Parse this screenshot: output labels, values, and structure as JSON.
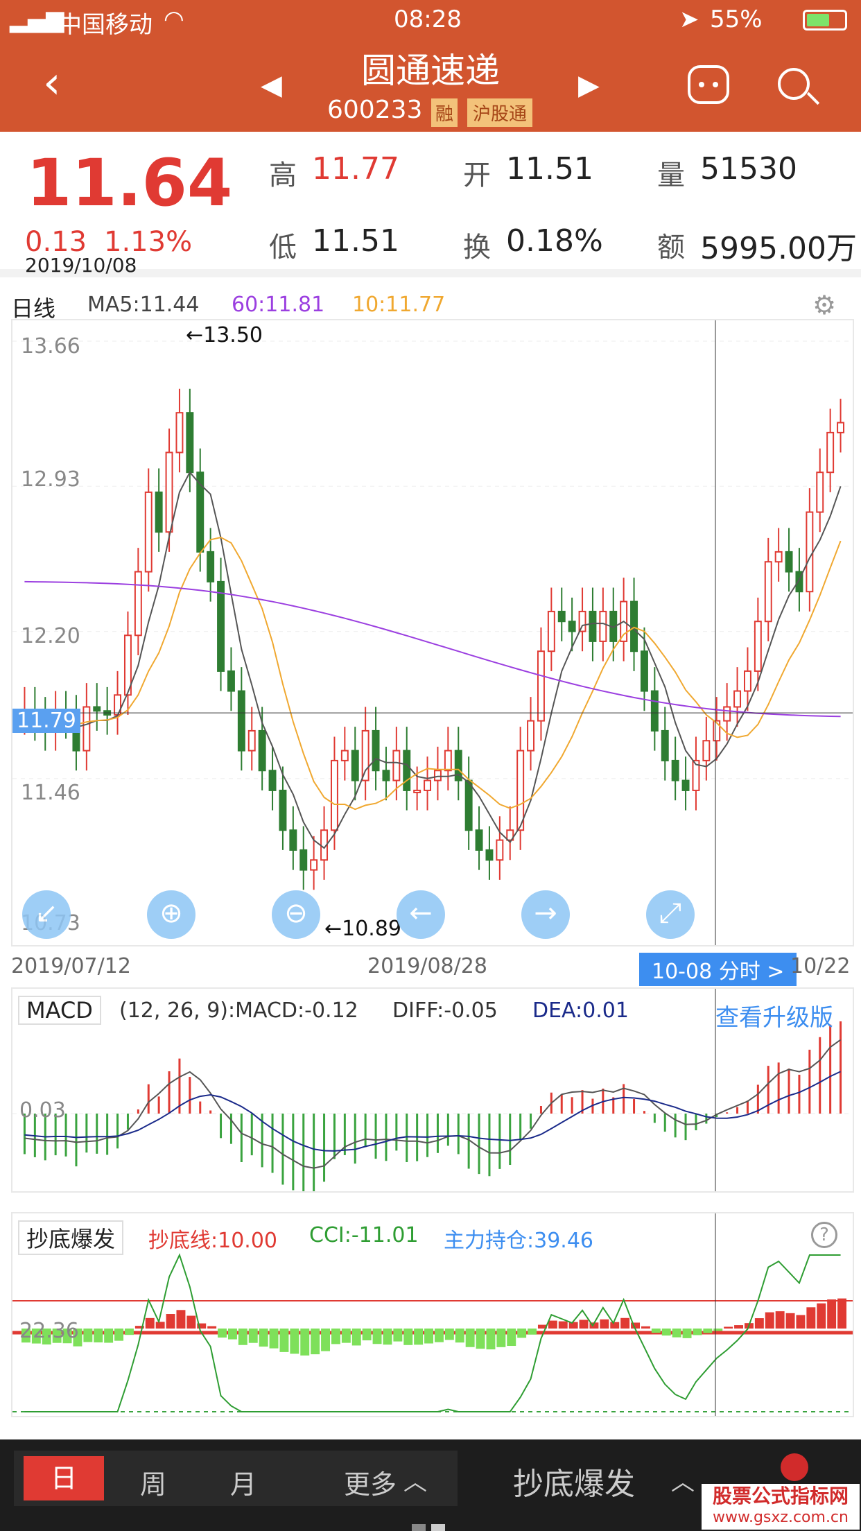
{
  "status_bar": {
    "carrier": "中国移动",
    "time": "08:28",
    "battery": "55%"
  },
  "header": {
    "title": "圆通速递",
    "code": "600233",
    "badge1": "融",
    "badge2": "沪股通"
  },
  "quote": {
    "price": "11.64",
    "change": "0.13",
    "change_pct": "1.13%",
    "date": "2019/10/08",
    "high_label": "高",
    "high": "11.77",
    "open_label": "开",
    "open": "11.51",
    "volume_label": "量",
    "volume": "51530",
    "low_label": "低",
    "low": "11.51",
    "turnover_label": "换",
    "turnover": "0.18%",
    "amount_label": "额",
    "amount": "5995.00万"
  },
  "kline": {
    "period": "日线",
    "ma5": "MA5:11.44",
    "ma60": "60:11.81",
    "ma10": "10:11.77",
    "y_labels": [
      "13.66",
      "12.93",
      "12.20",
      "11.46",
      "10.73"
    ],
    "crosshair_price": "11.79",
    "max_label": "←13.50",
    "min_label": "←10.89",
    "x_labels": [
      "2019/07/12",
      "2019/08/28",
      "10/22"
    ],
    "time_button": "10-08 分时 >"
  },
  "macd": {
    "name": "MACD",
    "params": "(12, 26, 9):MACD:-0.12",
    "diff": "DIFF:-0.05",
    "dea": "DEA:0.01",
    "zero_label": "0.03",
    "upgrade": "查看升级版"
  },
  "indicator": {
    "name": "抄底爆发",
    "line_label": "抄底线:10.00",
    "cci": "CCI:-11.01",
    "position": "主力持仓:39.46",
    "left_value": "22.36"
  },
  "bottom_tabs": {
    "day": "日",
    "week": "周",
    "month": "月",
    "more": "更多",
    "indicator_name": "抄底爆发"
  },
  "watermark": {
    "line1": "股票公式指标网",
    "line2": "www.gsxz.com.cn"
  },
  "colors": {
    "header": "#d2552f",
    "up": "#e03a33",
    "down": "#2e7d32",
    "ma5": "#555555",
    "ma10": "#f0a830",
    "ma60": "#9b3fe0"
  },
  "chart_data": [
    {
      "type": "candlestick",
      "title": "日线",
      "ylim": [
        10.73,
        13.66
      ],
      "x_range": [
        "2019/07/12",
        "2019/10/22"
      ],
      "ma": {
        "MA5": 11.44,
        "MA10": 11.77,
        "MA60": 11.81
      },
      "high_mark": 13.5,
      "low_mark": 10.89,
      "close": [
        11.8,
        11.75,
        11.7,
        11.78,
        11.76,
        11.6,
        11.82,
        11.8,
        11.78,
        11.88,
        12.18,
        12.5,
        12.9,
        12.7,
        13.1,
        13.3,
        13.0,
        12.6,
        12.45,
        12.0,
        11.9,
        11.6,
        11.7,
        11.5,
        11.4,
        11.2,
        11.1,
        11.0,
        11.05,
        11.2,
        11.55,
        11.6,
        11.45,
        11.7,
        11.5,
        11.45,
        11.6,
        11.4,
        11.4,
        11.45,
        11.5,
        11.6,
        11.45,
        11.2,
        11.1,
        11.05,
        11.15,
        11.2,
        11.6,
        11.75,
        12.1,
        12.3,
        12.25,
        12.2,
        12.3,
        12.15,
        12.3,
        12.15,
        12.35,
        12.1,
        11.9,
        11.7,
        11.55,
        11.45,
        11.4,
        11.55,
        11.65,
        11.75,
        11.82,
        11.9,
        12.0,
        12.25,
        12.55,
        12.6,
        12.5,
        12.4,
        12.8,
        13.0,
        13.2,
        13.25
      ]
    },
    {
      "type": "bar",
      "title": "MACD",
      "series": [
        {
          "name": "DIFF",
          "value": -0.05
        },
        {
          "name": "DEA",
          "value": 0.01
        },
        {
          "name": "MACD",
          "value": -0.12
        }
      ]
    },
    {
      "type": "line",
      "title": "抄底爆发",
      "series": [
        {
          "name": "抄底线",
          "value": 10.0
        },
        {
          "name": "CCI",
          "value": -11.01
        },
        {
          "name": "主力持仓",
          "value": 39.46
        }
      ]
    }
  ]
}
